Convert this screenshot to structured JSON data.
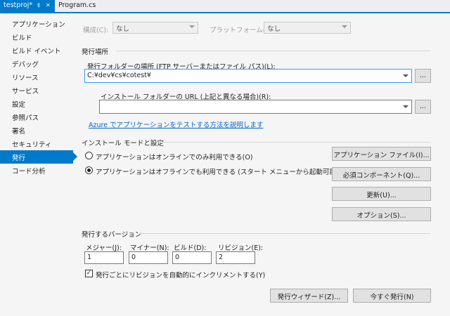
{
  "tabs": {
    "active_label": "testproj*",
    "pin_glyph": "‡",
    "close_glyph": "✕",
    "inactive_label": "Program.cs"
  },
  "nav": {
    "items": [
      "アプリケーション",
      "ビルド",
      "ビルド イベント",
      "デバッグ",
      "リソース",
      "サービス",
      "設定",
      "参照パス",
      "署名",
      "セキュリティ",
      "発行",
      "コード分析"
    ],
    "active": "発行"
  },
  "top": {
    "config_label": "構成(C):",
    "config_value": "なし",
    "platform_label": "プラットフォーム(M):",
    "platform_value": "なし"
  },
  "publish_location": {
    "title": "発行場所",
    "folder_label": "発行フォルダーの場所 (FTP サーバーまたはファイル パス)(L):",
    "folder_value": "C:¥dev¥cs¥cotest¥",
    "browse": "...",
    "install_url_label": "インストール フォルダーの URL (上記と異なる場合)(R):",
    "install_url_value": "",
    "azure_link": "Azure でアプリケーションをテストする方法を説明します"
  },
  "install_mode": {
    "title": "インストール モードと設定",
    "option_online": "アプリケーションはオンラインでのみ利用できる(O)",
    "option_offline": "アプリケーションはオフラインでも利用できる (スタート メニューから起動可能)(M)",
    "selected": "offline",
    "btn_app_files": "アプリケーション ファイル(I)...",
    "btn_prereq": "必須コンポーネント(Q)...",
    "btn_update": "更新(U)...",
    "btn_options": "オプション(S)..."
  },
  "version": {
    "title": "発行するバージョン",
    "major_label": "メジャー(J):",
    "minor_label": "マイナー(N):",
    "build_label": "ビルド(D):",
    "revision_label": "リビジョン(E):",
    "major": "1",
    "minor": "0",
    "build": "0",
    "revision": "2",
    "auto_increment_label": "発行ごとにリビジョンを自動的にインクリメントする(Y)",
    "auto_increment_checked": true
  },
  "footer": {
    "wizard_button": "発行ウィザード(Z)...",
    "publish_now_button": "今すぐ発行(N)"
  },
  "colors": {
    "accent": "#007acc",
    "link": "#0066cc"
  }
}
